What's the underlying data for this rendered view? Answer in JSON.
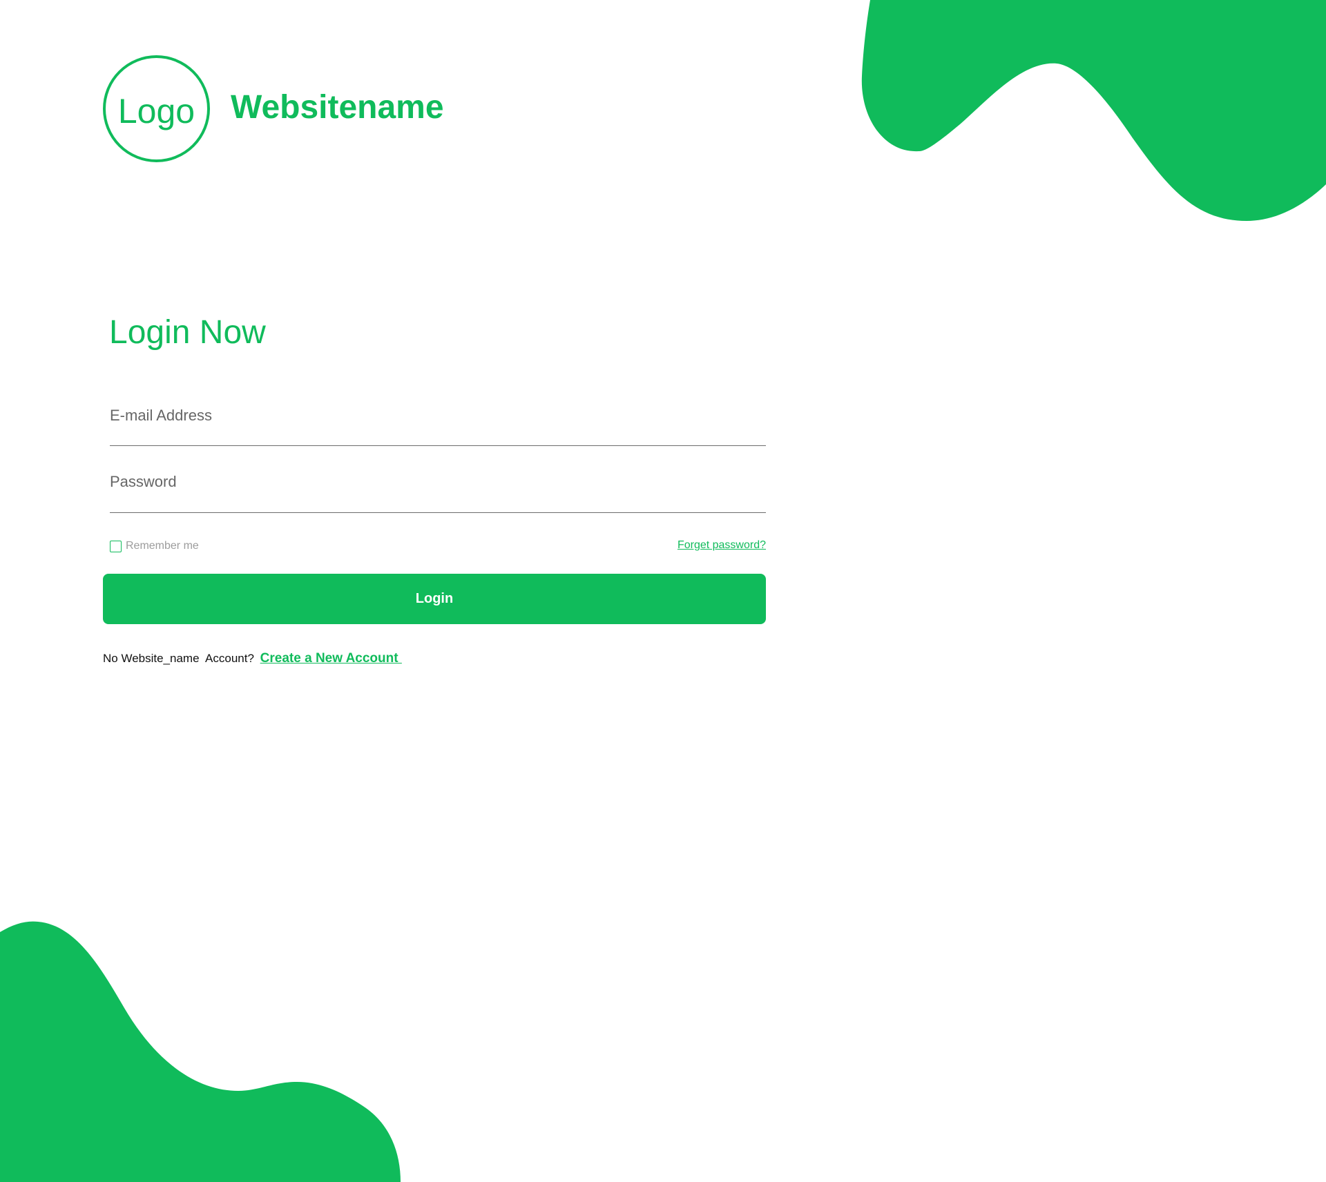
{
  "brand": {
    "logo_text": "Logo",
    "site_name": "Websitename",
    "accent_color": "#10bb5b"
  },
  "login": {
    "title": "Login Now",
    "email_placeholder": "E-mail Address",
    "password_placeholder": "Password",
    "remember_label": "Remember me",
    "forgot_label": "Forget password?",
    "button_label": "Login",
    "no_account_text": "No Website_name  Account?",
    "create_account_label": "Create a New Account "
  }
}
